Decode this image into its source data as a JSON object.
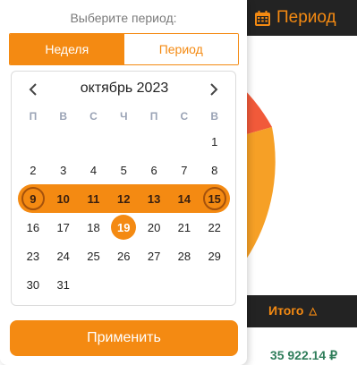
{
  "background": {
    "header": {
      "period_label": "Период",
      "icon": "calendar-icon"
    },
    "table": {
      "total_header": "Итого",
      "sort_icon": "triangle-up-icon",
      "total_value": "35 922.14 ₽"
    }
  },
  "popup": {
    "title": "Выберите период:",
    "segments": [
      {
        "label": "Неделя",
        "active": true
      },
      {
        "label": "Период",
        "active": false
      }
    ],
    "calendar": {
      "month_label": "октябрь 2023",
      "weekdays": [
        "П",
        "В",
        "С",
        "Ч",
        "П",
        "С",
        "В"
      ],
      "leading_blanks": 6,
      "days": [
        "1",
        "2",
        "3",
        "4",
        "5",
        "6",
        "7",
        "8",
        "9",
        "10",
        "11",
        "12",
        "13",
        "14",
        "15",
        "16",
        "17",
        "18",
        "19",
        "20",
        "21",
        "22",
        "23",
        "24",
        "25",
        "26",
        "27",
        "28",
        "29",
        "30",
        "31"
      ],
      "range_start": 9,
      "range_end": 15,
      "today": 19
    },
    "apply_label": "Применить"
  },
  "colors": {
    "accent": "#f48a12",
    "dark_bar": "#232323",
    "pie_red": "#f15a3a",
    "pie_orange": "#f6a026",
    "total_green": "#2f7d5a",
    "weekday_gray": "#9aa3b5"
  }
}
